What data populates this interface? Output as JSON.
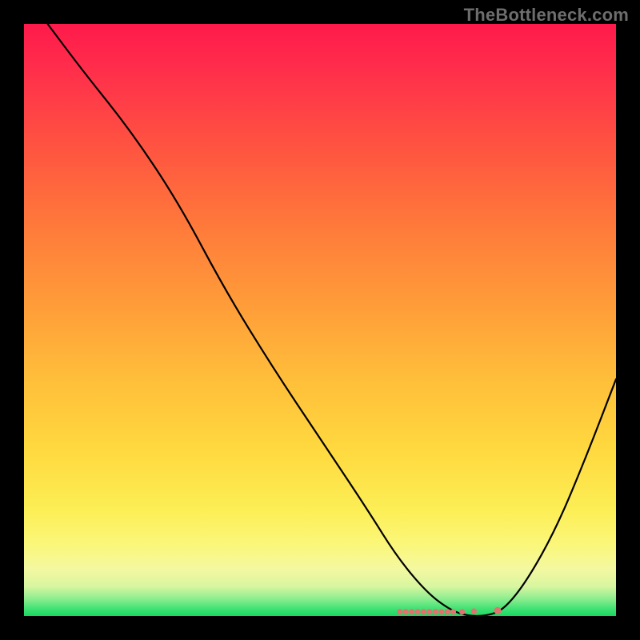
{
  "watermark": "TheBottleneck.com",
  "chart_data": {
    "type": "line",
    "title": "",
    "xlabel": "",
    "ylabel": "",
    "xlim": [
      0,
      100
    ],
    "ylim": [
      0,
      100
    ],
    "gradient_stops": [
      {
        "pos": 0,
        "color": "#ff1a4b"
      },
      {
        "pos": 8,
        "color": "#ff2f4b"
      },
      {
        "pos": 22,
        "color": "#ff5740"
      },
      {
        "pos": 35,
        "color": "#ff7c3a"
      },
      {
        "pos": 48,
        "color": "#ff9e39"
      },
      {
        "pos": 60,
        "color": "#ffbe3a"
      },
      {
        "pos": 72,
        "color": "#ffd93f"
      },
      {
        "pos": 82,
        "color": "#fcee55"
      },
      {
        "pos": 88,
        "color": "#fbf77a"
      },
      {
        "pos": 92,
        "color": "#f4f8a0"
      },
      {
        "pos": 95,
        "color": "#d8f6a0"
      },
      {
        "pos": 97,
        "color": "#90ee90"
      },
      {
        "pos": 99,
        "color": "#38e070"
      },
      {
        "pos": 100,
        "color": "#18d95f"
      }
    ],
    "series": [
      {
        "name": "bottleneck-curve",
        "x": [
          4,
          10,
          18,
          26,
          34,
          42,
          50,
          58,
          63,
          68,
          72,
          75,
          78,
          81,
          85,
          90,
          95,
          100
        ],
        "y": [
          100,
          92,
          82,
          70,
          55,
          42,
          30,
          18,
          10,
          4,
          1,
          0,
          0,
          1,
          6,
          15,
          27,
          40
        ]
      }
    ],
    "markers": {
      "name": "data-points",
      "x": [
        63.5,
        64.5,
        65.5,
        66.5,
        67.5,
        68.5,
        69.5,
        70.5,
        71.5,
        72.5,
        74.0,
        76.0,
        80.0
      ],
      "y": [
        0.7,
        0.7,
        0.7,
        0.7,
        0.7,
        0.7,
        0.7,
        0.7,
        0.7,
        0.7,
        0.7,
        0.8,
        0.9
      ],
      "color": "#e0736f"
    }
  }
}
